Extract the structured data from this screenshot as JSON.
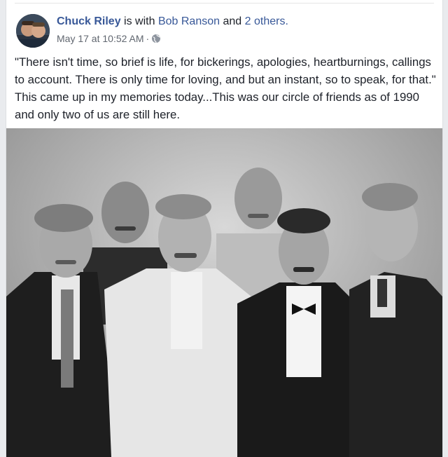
{
  "post": {
    "author": "Chuck Riley",
    "with_text": "is with",
    "tagged_person": "Bob Ranson",
    "and_text": "and",
    "others_link": "2 others.",
    "timestamp": "May 17 at 10:52 AM",
    "separator": "·",
    "privacy_icon": "globe-icon",
    "text": "\"There isn't time, so brief is life, for bickerings, apologies, heartburnings, callings to account. There is only time for loving, and but an instant, so to speak, for that.\" This came up in my memories today...This was our circle of friends as of 1990 and only two of us are still here.",
    "photo_alt": "Black and white group photo of five men in tuxedos and suits"
  },
  "colors": {
    "link": "#385898",
    "text": "#1d2129",
    "meta": "#616770",
    "background": "#e9ebee"
  }
}
